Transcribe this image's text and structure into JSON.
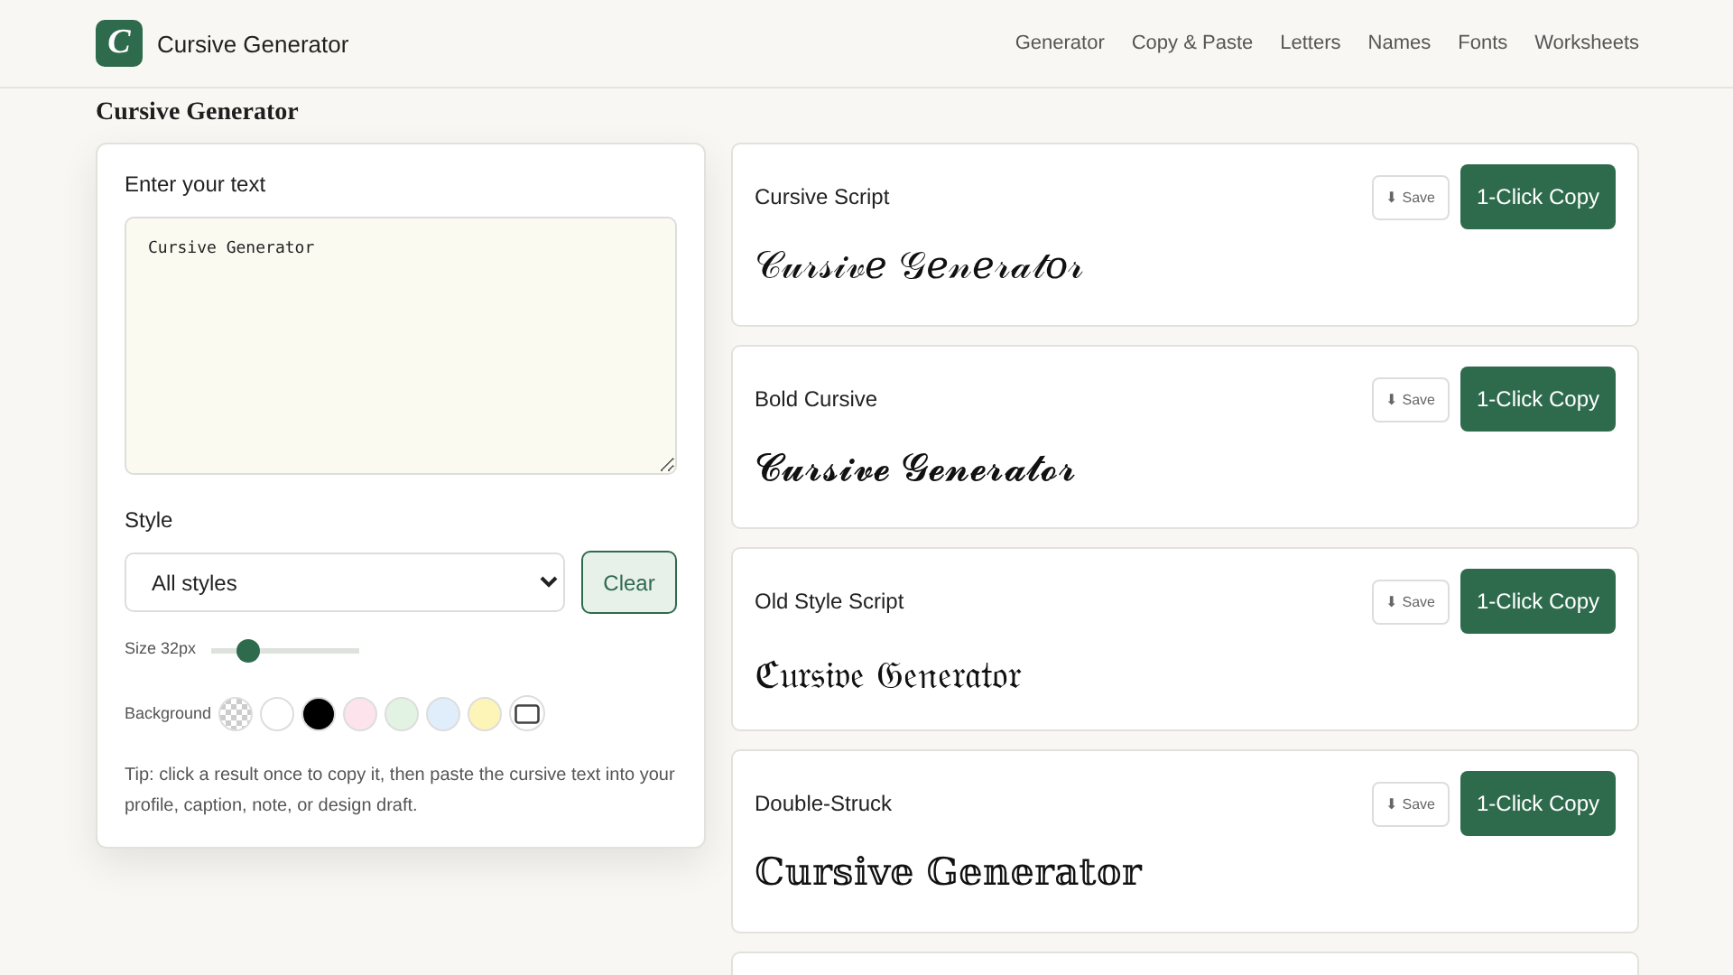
{
  "header": {
    "logo_letter": "C",
    "site_name": "Cursive Generator",
    "nav": [
      {
        "label": "Generator"
      },
      {
        "label": "Copy & Paste"
      },
      {
        "label": "Letters"
      },
      {
        "label": "Names"
      },
      {
        "label": "Fonts"
      },
      {
        "label": "Worksheets"
      }
    ]
  },
  "page_title": "Cursive Generator",
  "editor": {
    "input_label": "Enter your text",
    "input_value": "Cursive Generator",
    "style_label": "Style",
    "style_value": "All styles",
    "clear_button": "Clear",
    "size_label": "Size 32px",
    "size": {
      "level": 0.26
    },
    "background_label": "Background",
    "swatches": [
      {
        "kind": "transparent"
      },
      {
        "kind": "color",
        "color": "#ffffff"
      },
      {
        "kind": "color",
        "color": "#000000"
      },
      {
        "kind": "color",
        "color": "#fde4ec"
      },
      {
        "kind": "color",
        "color": "#e3f3e3"
      },
      {
        "kind": "color",
        "color": "#e0eefc"
      },
      {
        "kind": "color",
        "color": "#fdf5b8"
      },
      {
        "kind": "custom"
      }
    ],
    "tip": "Tip: click a result once to copy it, then paste the cursive text into your profile, caption, note, or design draft."
  },
  "results": [
    {
      "name": "Cursive Script",
      "output": "𝒞𝓊𝓇𝓈𝒾𝓋𝑒 𝒢𝑒𝓃𝑒𝓇𝒶𝓉𝑜𝓇",
      "save": "⬇ Save",
      "copy": "1-Click Copy"
    },
    {
      "name": "Bold Cursive",
      "output": "𝓒𝓾𝓻𝓼𝓲𝓿𝓮 𝓖𝓮𝓷𝓮𝓻𝓪𝓽𝓸𝓻",
      "save": "⬇ Save",
      "copy": "1-Click Copy"
    },
    {
      "name": "Old Style Script",
      "output": "ℭ𝔲𝔯𝔰𝔦𝔳𝔢 𝔊𝔢𝔫𝔢𝔯𝔞𝔱𝔬𝔯",
      "save": "⬇ Save",
      "copy": "1-Click Copy"
    },
    {
      "name": "Double-Struck",
      "output": "ℂ𝕦𝕣𝕤𝕚𝕧𝕖 𝔾𝕖𝕟𝕖𝕣𝕒𝕥𝕠𝕣",
      "save": "⬇ Save",
      "copy": "1-Click Copy"
    },
    {
      "kind": "cut-off"
    }
  ]
}
